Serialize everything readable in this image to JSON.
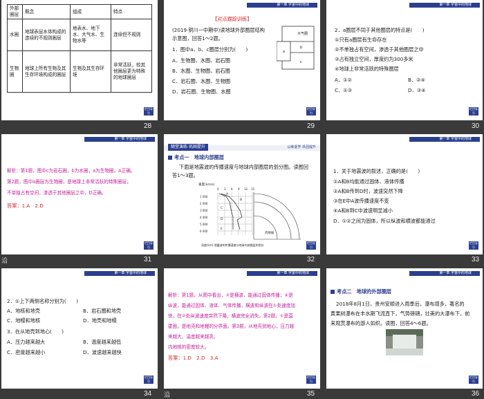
{
  "header_text": "第一章 宇宙中的地球",
  "nav_label": "栏目导引",
  "slide_numbers": [
    "28",
    "29",
    "30",
    "31",
    "32",
    "33",
    "34",
    "35",
    "36"
  ],
  "below_label": "沿",
  "s28": {
    "headers": [
      "外部圈层",
      "概念",
      "组成",
      "特点"
    ],
    "rows": [
      [
        "",
        "",
        "",
        "连续但不规则"
      ],
      [
        "水圈",
        "地球表层水体构成的连续的不规则圈层",
        "地表水、地下水、大气水、生物水等",
        "连续但不规则"
      ],
      [
        "生物圈",
        "地球上所有生物及其生存环境构成的圈层",
        "生物及其生存环境",
        "非常活跃，较其他圈层更为特殊的地球圈层"
      ]
    ]
  },
  "s29": {
    "tag": "【对点跟踪训练】",
    "lines": [
      "(2019·铜川一中期中)读地球外部圈层结构",
      "示意图，回答1～2题。",
      "1．图中a、b、c圈层分别为(　　)",
      "A．生物圈、水圈、岩石圈",
      "B．水圈、生物圈、岩石圈",
      "C．岩石圈、水圈、生物圈",
      "D．岩石圈、生物圈、水圈"
    ],
    "diagram_labels": [
      "大气圈",
      "a",
      "b",
      "c"
    ]
  },
  "s30": {
    "lines": [
      "2．a圈层不同于其他圈层的特点是(　　)",
      "①只有a圈层有生命存在",
      "②不单独占有空间，渗透于其他圈层之中",
      "③占有独立空间，厚度约为300多米",
      "④地球上非常活跃的特殊圈层"
    ],
    "options": [
      "A．①②",
      "B．②④",
      "C．①③",
      "D．③④"
    ]
  },
  "s31": {
    "lines": [
      "解析：第1题，图中c为岩石圈，b为水圈，a为生物圈。A正确。",
      "第2题，图中a圈层为生物圈，是地球上非常活跃的特殊圈层，",
      "不单独占有空间，渗透于其他圈层之中，D正确。"
    ],
    "answer": "答案：1.A　2.D"
  },
  "s32": {
    "banner": "随堂演练·巩固提升",
    "banner_right": "以练促学·巩固提升",
    "topic": "考点一　地球内部圈层",
    "lines": [
      "下面是地震波的传播速度与地球内部圈层的划分图。读图回",
      "答1～3题。"
    ],
    "axis_title": "速度(km/s)",
    "x_ticks": [
      "0",
      "3",
      "6",
      "9",
      "12",
      "15"
    ],
    "y_ticks": [
      "1 000",
      "2 000",
      "3 000",
      "4 000",
      "5 000",
      "6 000"
    ],
    "labels": [
      "A",
      "B",
      "C",
      "D",
      "E",
      "内地核"
    ],
    "caption": "深度(km) 地震波的传播速度与地球内部圈层的划分"
  },
  "s33": {
    "lines": [
      "1．关于地震波的叙述，正确的是(　　)",
      "①A和B均能通过固体、液体传播",
      "②A和B传到D时，波速突然下降",
      "③在E中A波传播速度不变",
      "④A和B到C中波速明显减小"
    ],
    "options": [
      "A．①②",
      "B．③④",
      "C．②③",
      "D．①②之间为固体，所以纵波和横波都能通过"
    ]
  },
  "s34": {
    "lines": [
      "2．①上下两侧名称分别为(　　)",
      "A．地核和地壳",
      "B．岩石圈和地壳",
      "C．地幔和地核",
      "D．地壳和地幔",
      "3．在从地壳到地心(　　)",
      "A．压力越来越大",
      "B．温度越来越低",
      "C．密度越来越小",
      "D．波速越来越快"
    ]
  },
  "s35": {
    "lines": [
      "解析：第1题，从图中看出，②是横波，能通过固体传播；④是",
      "纵波，能通过固体、液体、气体传播，横波和纵波在①处速度加",
      "快，在②处纵波速度突然下降，横波完全消失，第2题，①是莫",
      "霍面，是地壳和地幔的分界面。第3题，从地壳到地心，压力越",
      "来越大，温度越来越高，",
      "内地核的密度较大。"
    ],
    "answer": "答案：1.D　2.D　3.A"
  },
  "s36": {
    "topic": "考点二　地球的外部圈层",
    "lines": [
      "2018年8月1日，贵州安顺进入雨季后，瀑布增多，著名的",
      "黄果树瀑布在丰水期飞流直下，气势磅礴，壮美的大瀑布下，前",
      "来观赏瀑布的游人如织。读图，回答4～6题。"
    ]
  }
}
